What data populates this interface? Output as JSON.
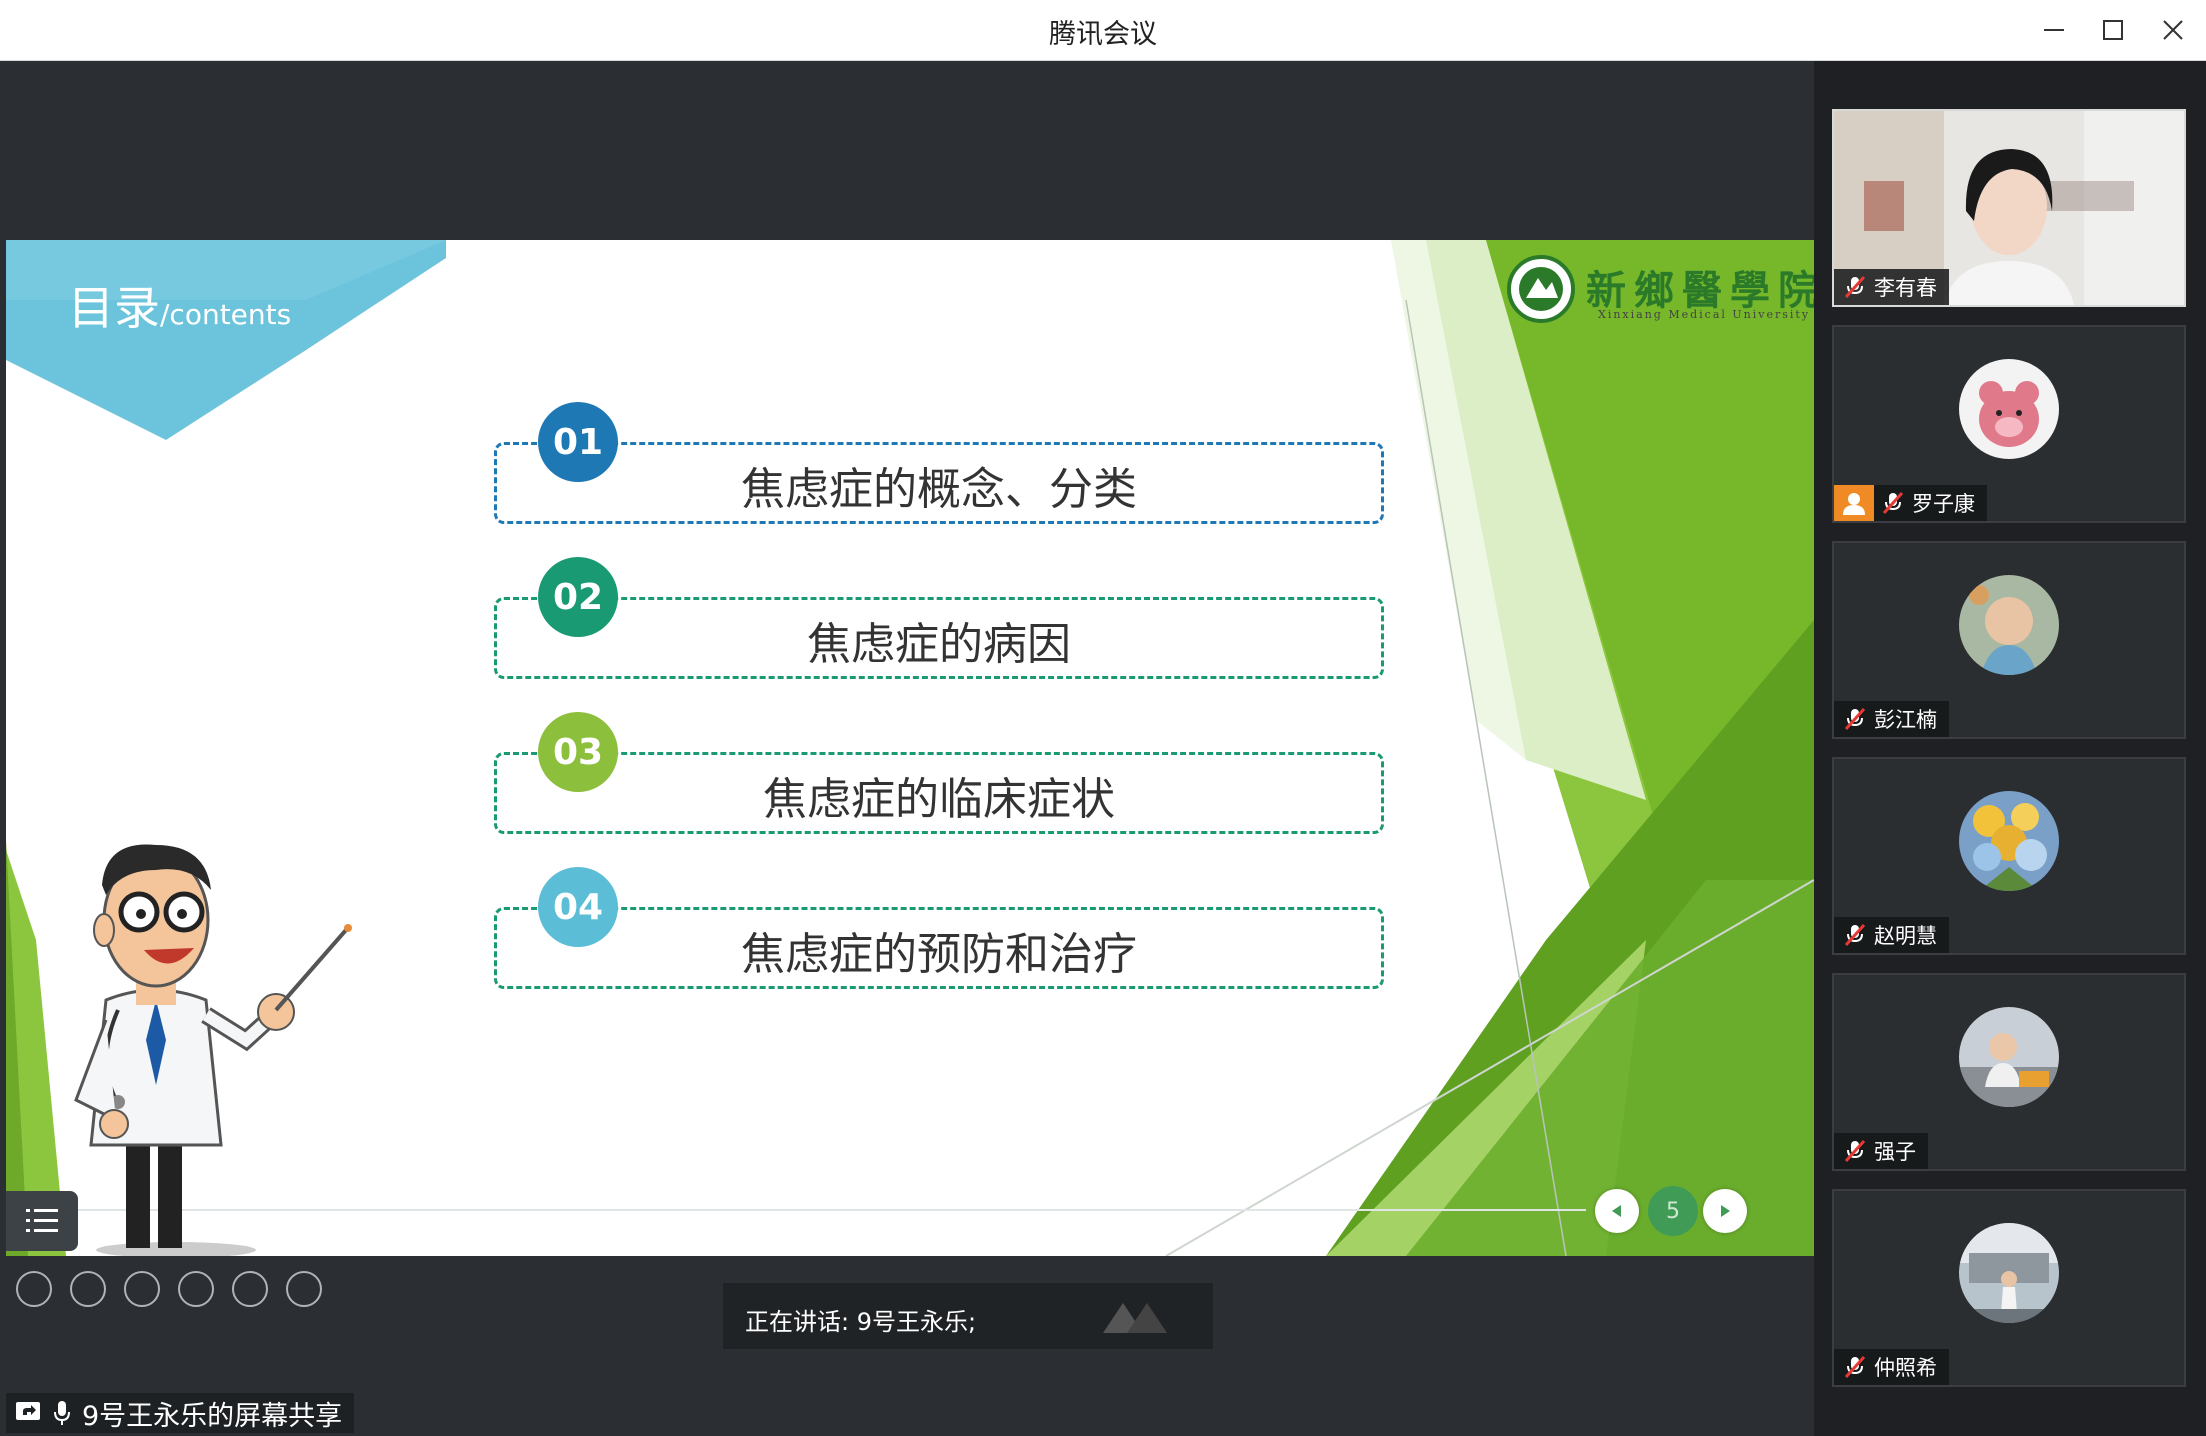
{
  "window": {
    "title": "腾讯会议",
    "controls": [
      "minimize-icon",
      "maximize-icon",
      "close-icon"
    ]
  },
  "slide": {
    "header_main": "目录",
    "header_sub": "/contents",
    "logo_name": "新鄉醫學院",
    "logo_en": "Xinxiang Medical University",
    "items": [
      {
        "num": "01",
        "text": "焦虑症的概念、分类",
        "color": "#1e78b4"
      },
      {
        "num": "02",
        "text": "焦虑症的病因",
        "color": "#1a9a72"
      },
      {
        "num": "03",
        "text": "焦虑症的临床症状",
        "color": "#8cbf3c"
      },
      {
        "num": "04",
        "text": "焦虑症的预防和治疗",
        "color": "#5bbdd6"
      }
    ],
    "page_number": "5"
  },
  "speaking": {
    "label": "正在讲话: 9号王永乐;"
  },
  "share": {
    "label": "9号王永乐的屏幕共享"
  },
  "participants": [
    {
      "name": "李有春",
      "muted": true,
      "video": true
    },
    {
      "name": "罗子康",
      "muted": true,
      "host": true
    },
    {
      "name": "彭江楠",
      "muted": true
    },
    {
      "name": "赵明慧",
      "muted": true
    },
    {
      "name": "强子",
      "muted": true
    },
    {
      "name": "仲照希",
      "muted": true
    }
  ],
  "colors": {
    "accent_green": "#7ab63a",
    "accent_blue": "#6cc4dc",
    "host_orange": "#f08a24"
  }
}
